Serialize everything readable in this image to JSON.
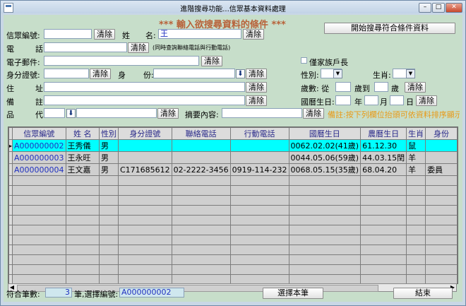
{
  "window": {
    "title": "進階搜尋功能...信眾基本資料處理"
  },
  "header": {
    "title": "*** 輸入欲搜尋資料的條件 ***",
    "search_button": "開始搜尋符合條件資料"
  },
  "form": {
    "member_id_label": "信眾編號:",
    "clear": "清除",
    "surname_label": "姓",
    "name_label": "名:",
    "name_value": "王",
    "phone_label_1": "電",
    "phone_label_2": "話:",
    "phone_note": "(同時查詢聯絡電話與行動電話)",
    "email_label": "電子郵件:",
    "household_label": "僅家族戶長",
    "id_label": "身分證號:",
    "role_label_1": "身",
    "role_label_2": "份:",
    "gender_label": "性別:",
    "zodiac_label": "生肖:",
    "address_label_1": "住",
    "address_label_2": "址:",
    "age_label": "歲數: 從",
    "age_to": "歲到",
    "age_unit": "歲",
    "note_label_1": "備",
    "note_label_2": "註:",
    "birth_label": "國曆生日:",
    "year": "年",
    "month": "月",
    "day": "日",
    "grade_label_1": "品",
    "grade_label_2": "代:",
    "summary_label": "摘要內容:",
    "hint": "備註:按下列欄位抬頭可依資料排序顯示"
  },
  "grid": {
    "columns": [
      "信眾編號",
      "姓 名",
      "性別",
      "身分證號",
      "聯絡電話",
      "行動電話",
      "國曆生日",
      "農曆生日",
      "生肖",
      "身份"
    ],
    "rows": [
      [
        "A000000002",
        "王秀儀",
        "男",
        "",
        "",
        "",
        "0062.02.02(41歲)",
        "61.12.30",
        "鼠",
        ""
      ],
      [
        "A000000003",
        "王永旺",
        "男",
        "",
        "",
        "",
        "0044.05.06(59歲)",
        "44.03.15閏",
        "羊",
        ""
      ],
      [
        "A000000004",
        "王文嘉",
        "男",
        "C171685612",
        "02-2222-3456",
        "0919-114-232",
        "0068.05.15(35歲)",
        "68.04.20",
        "羊",
        "委員"
      ]
    ],
    "empty_rows": 13
  },
  "footer": {
    "count_label": "符合筆數:",
    "count_value": "3",
    "selected_label": "筆,選擇編號:",
    "selected_value": "A000000002",
    "select_button": "選擇本筆",
    "close_button": "結束"
  }
}
